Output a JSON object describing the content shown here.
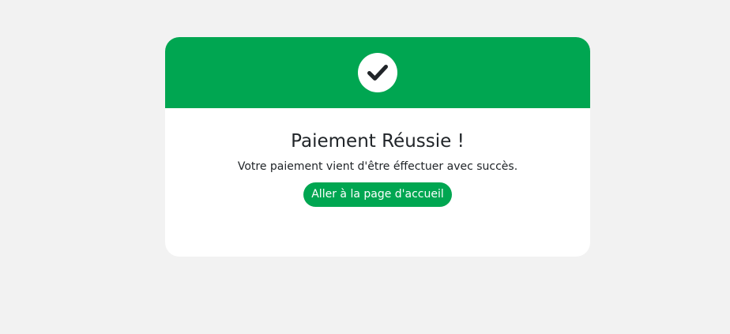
{
  "card": {
    "status_icon": "check-icon",
    "title": "Paiement Réussie !",
    "message": "Votre paiement vient d'être éffectuer avec succès.",
    "home_button_label": "Aller à la page d'accueil"
  },
  "colors": {
    "background": "#f2f2f2",
    "accent": "#00a651",
    "card": "#ffffff",
    "icon": "#212529"
  }
}
